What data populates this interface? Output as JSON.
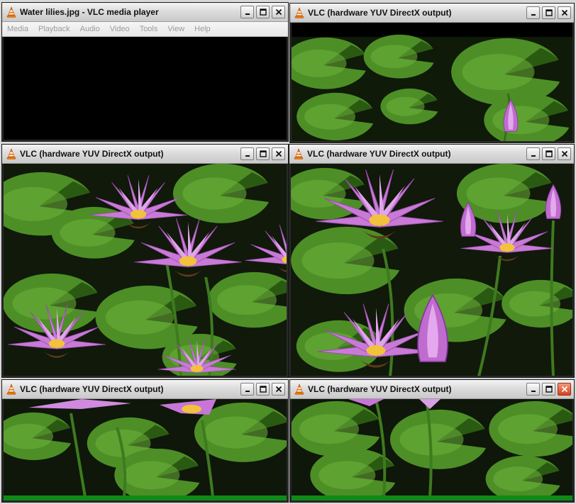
{
  "windows": [
    {
      "title": "Water lilies.jpg - VLC media player"
    },
    {
      "title": "VLC (hardware YUV DirectX output)"
    },
    {
      "title": "VLC (hardware YUV DirectX output)"
    },
    {
      "title": "VLC (hardware YUV DirectX output)"
    },
    {
      "title": "VLC (hardware YUV DirectX output)"
    },
    {
      "title": "VLC (hardware YUV DirectX output)"
    }
  ],
  "menu": [
    "Media",
    "Playback",
    "Audio",
    "Video",
    "Tools",
    "View",
    "Help"
  ],
  "colors": {
    "vlc_orange": "#f07b0e",
    "close_active": "#d7421c",
    "progress_green": "#0f8a17"
  }
}
